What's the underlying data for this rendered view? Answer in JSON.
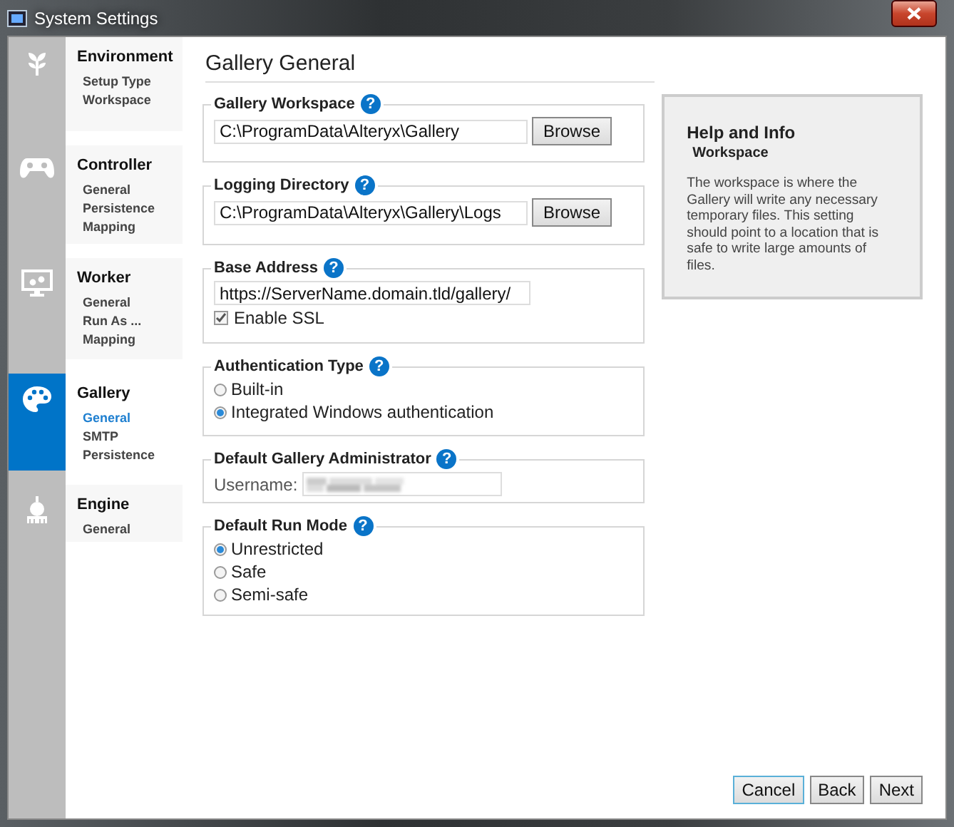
{
  "window": {
    "title": "System Settings"
  },
  "nav": [
    {
      "title": "Environment",
      "selected": false,
      "items": [
        {
          "label": "Setup Type",
          "selected": false
        },
        {
          "label": "Workspace",
          "selected": false
        }
      ]
    },
    {
      "title": "Controller",
      "selected": false,
      "items": [
        {
          "label": "General",
          "selected": false
        },
        {
          "label": "Persistence",
          "selected": false
        },
        {
          "label": "Mapping",
          "selected": false
        }
      ]
    },
    {
      "title": "Worker",
      "selected": false,
      "items": [
        {
          "label": "General",
          "selected": false
        },
        {
          "label": "Run As ...",
          "selected": false
        },
        {
          "label": "Mapping",
          "selected": false
        }
      ]
    },
    {
      "title": "Gallery",
      "selected": true,
      "items": [
        {
          "label": "General",
          "selected": true
        },
        {
          "label": "SMTP",
          "selected": false
        },
        {
          "label": "Persistence",
          "selected": false
        }
      ]
    },
    {
      "title": "Engine",
      "selected": false,
      "items": [
        {
          "label": "General",
          "selected": false
        }
      ]
    }
  ],
  "page_title": "Gallery General",
  "help_glyph": "?",
  "groups": [
    {
      "kind": "path",
      "title": "Gallery Workspace",
      "value": "C:\\ProgramData\\Alteryx\\Gallery",
      "button": "Browse"
    },
    {
      "kind": "path",
      "title": "Logging Directory",
      "value": "C:\\ProgramData\\Alteryx\\Gallery\\Logs",
      "button": "Browse"
    },
    {
      "kind": "url",
      "title": "Base Address",
      "value": "https://ServerName.domain.tld/gallery/",
      "checkbox": {
        "label": "Enable SSL",
        "checked": true
      }
    },
    {
      "kind": "radio",
      "title": "Authentication Type",
      "options": [
        {
          "label": "Built-in",
          "selected": false
        },
        {
          "label": "Integrated Windows authentication",
          "selected": true
        }
      ]
    },
    {
      "kind": "user",
      "title": "Default Gallery Administrator",
      "label": "Username:"
    },
    {
      "kind": "radio",
      "title": "Default Run Mode",
      "options": [
        {
          "label": "Unrestricted",
          "selected": true
        },
        {
          "label": "Safe",
          "selected": false
        },
        {
          "label": "Semi-safe",
          "selected": false
        }
      ]
    }
  ],
  "help": {
    "title": "Help and Info",
    "subtitle": "Workspace",
    "text": "The workspace is where the Gallery will write any necessary temporary files. This setting should point to a location that is safe to write large amounts of files."
  },
  "buttons": [
    "Cancel",
    "Back",
    "Next"
  ]
}
